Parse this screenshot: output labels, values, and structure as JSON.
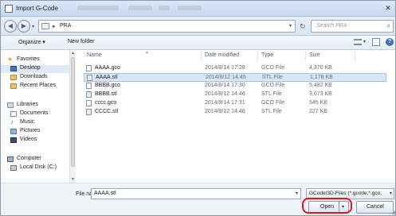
{
  "window": {
    "title": "Import G-Code",
    "close_glyph": "✕"
  },
  "address": {
    "crumb": "PRA",
    "separator": "▸",
    "search_placeholder": "Search PRA",
    "back_glyph": "◀",
    "forward_glyph": "▶",
    "refresh_glyph": "↻",
    "search_glyph": "⌕"
  },
  "toolbar": {
    "organize": "Organize ▾",
    "new_folder": "New folder",
    "help_glyph": "?"
  },
  "navpane": {
    "favorites": {
      "label": "Favorites",
      "items": [
        "Desktop",
        "Downloads",
        "Recent Places"
      ]
    },
    "libraries": {
      "label": "Libraries",
      "items": [
        "Documents",
        "Music",
        "Pictures",
        "Videos"
      ]
    },
    "computer": {
      "label": "Computer",
      "items": [
        "Local Disk (C:)"
      ]
    }
  },
  "filelist": {
    "columns": [
      "Name",
      "Date modified",
      "Type",
      "Size"
    ],
    "rows": [
      {
        "name": "AAAA.gco",
        "date": "2014/8/14 17:28",
        "type": "GCO File",
        "size": "4,370 KB",
        "kind": "gco",
        "selected": false
      },
      {
        "name": "AAAA.stl",
        "date": "2014/8/12 14:45",
        "type": "STL File",
        "size": "1,178 KB",
        "kind": "stl",
        "selected": true
      },
      {
        "name": "BBBB.gco",
        "date": "2014/8/14 17:30",
        "type": "GCO File",
        "size": "5,482 KB",
        "kind": "gco",
        "selected": false
      },
      {
        "name": "BBBB.stl",
        "date": "2014/8/12 14:46",
        "type": "STL File",
        "size": "3,073 KB",
        "kind": "stl",
        "selected": false
      },
      {
        "name": "cccc.gco",
        "date": "2014/8/14 17:31",
        "type": "GCO File",
        "size": "545 KB",
        "kind": "gco",
        "selected": false
      },
      {
        "name": "CCCC.stl",
        "date": "2014/8/12 14:46",
        "type": "STL File",
        "size": "227 KB",
        "kind": "stl",
        "selected": false
      }
    ]
  },
  "bottom": {
    "filename_label": "File name:",
    "filename_value": "AAAA.stl",
    "filetype_value": "GCode/3D-Files (*.gcode;*.gco;",
    "open_label": "Open",
    "cancel_label": "Cancel"
  },
  "colors": {
    "highlight": "#e4161a",
    "selection": "#d9e6f6",
    "accent": "#3f6fb5"
  }
}
